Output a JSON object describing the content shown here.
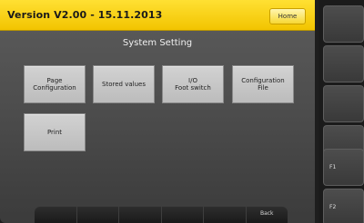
{
  "header": {
    "version": "Version V2.00 - 15.11.2013",
    "home_label": "Home"
  },
  "panel": {
    "title": "System Setting"
  },
  "buttons": {
    "page_configuration": "Page\nConfiguration",
    "stored_values": "Stored values",
    "io_foot_switch": "I/O\nFoot switch",
    "configuration_file": "Configuration\nFile",
    "print": "Print"
  },
  "bottom_bar": {
    "slots": [
      "",
      "",
      "",
      "",
      "",
      "Back"
    ]
  },
  "side_keys": {
    "f1": "F1",
    "f2": "F2"
  },
  "colors": {
    "title_bar": "#f2c400",
    "panel_bg": "#4e4e4e",
    "button_bg": "#c8c8c8"
  }
}
